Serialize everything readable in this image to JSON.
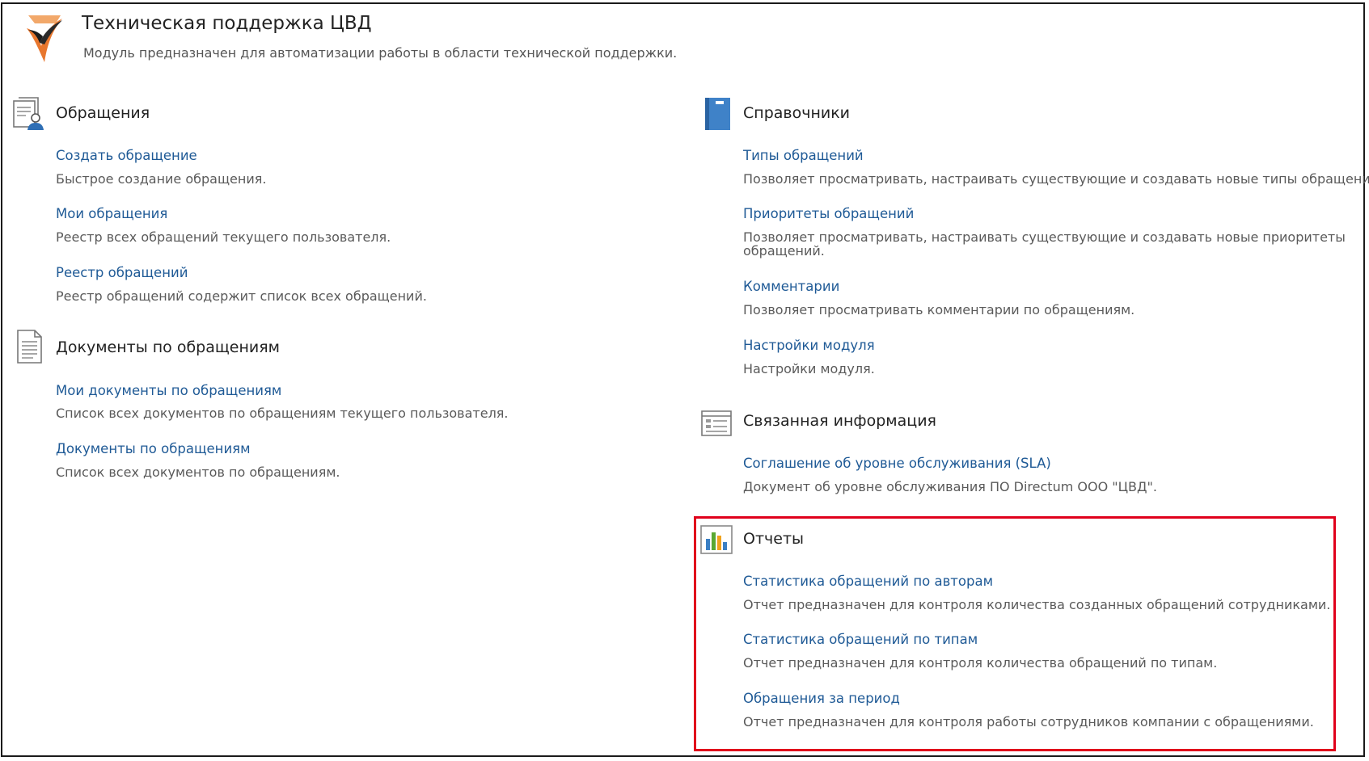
{
  "header": {
    "title": "Техническая поддержка ЦВД",
    "subtitle": "Модуль предназначен для автоматизации работы в области технической поддержки."
  },
  "sections": {
    "appeals": {
      "title": "Обращения",
      "icon": "appeal-user-document-icon",
      "items": [
        {
          "link": "Создать обращение",
          "desc": "Быстрое создание обращения."
        },
        {
          "link": "Мои обращения",
          "desc": "Реестр всех обращений текущего пользователя."
        },
        {
          "link": "Реестр обращений",
          "desc": "Реестр обращений содержит список всех обращений."
        }
      ]
    },
    "documents": {
      "title": "Документы по обращениям",
      "icon": "document-list-icon",
      "items": [
        {
          "link": "Мои документы по обращениям",
          "desc": "Список всех документов по обращениям текущего пользователя."
        },
        {
          "link": "Документы по обращениям",
          "desc": "Список всех документов по обращениям."
        }
      ]
    },
    "references": {
      "title": "Справочники",
      "icon": "book-icon",
      "items": [
        {
          "link": "Типы обращений",
          "desc": "Позволяет просматривать, настраивать существующие и создавать новые типы обращений."
        },
        {
          "link": "Приоритеты обращений",
          "desc": "Позволяет просматривать, настраивать существующие и создавать новые приоритеты обращений."
        },
        {
          "link": "Комментарии",
          "desc": "Позволяет просматривать комментарии по обращениям."
        },
        {
          "link": "Настройки модуля",
          "desc": "Настройки модуля."
        }
      ]
    },
    "related": {
      "title": "Связанная информация",
      "icon": "info-panel-icon",
      "items": [
        {
          "link": "Соглашение об уровне обслуживания (SLA)",
          "desc": "Документ об уровне обслуживания ПО Directum ООО \"ЦВД\"."
        }
      ]
    },
    "reports": {
      "title": "Отчеты",
      "icon": "bar-chart-icon",
      "items": [
        {
          "link": "Статистика обращений по авторам",
          "desc": "Отчет предназначен для контроля количества созданных обращений сотрудниками."
        },
        {
          "link": "Статистика обращений по типам",
          "desc": "Отчет предназначен для контроля количества обращений по типам."
        },
        {
          "link": "Обращения за период",
          "desc": "Отчет предназначен для контроля работы сотрудников компании с обращениями."
        }
      ]
    }
  },
  "colors": {
    "link": "#1f5a96",
    "highlight": "#e0001b",
    "logo_orange": "#e8772e",
    "chart_blue": "#3a7fc4",
    "chart_green": "#5aa832",
    "chart_orange": "#f0a21c"
  }
}
